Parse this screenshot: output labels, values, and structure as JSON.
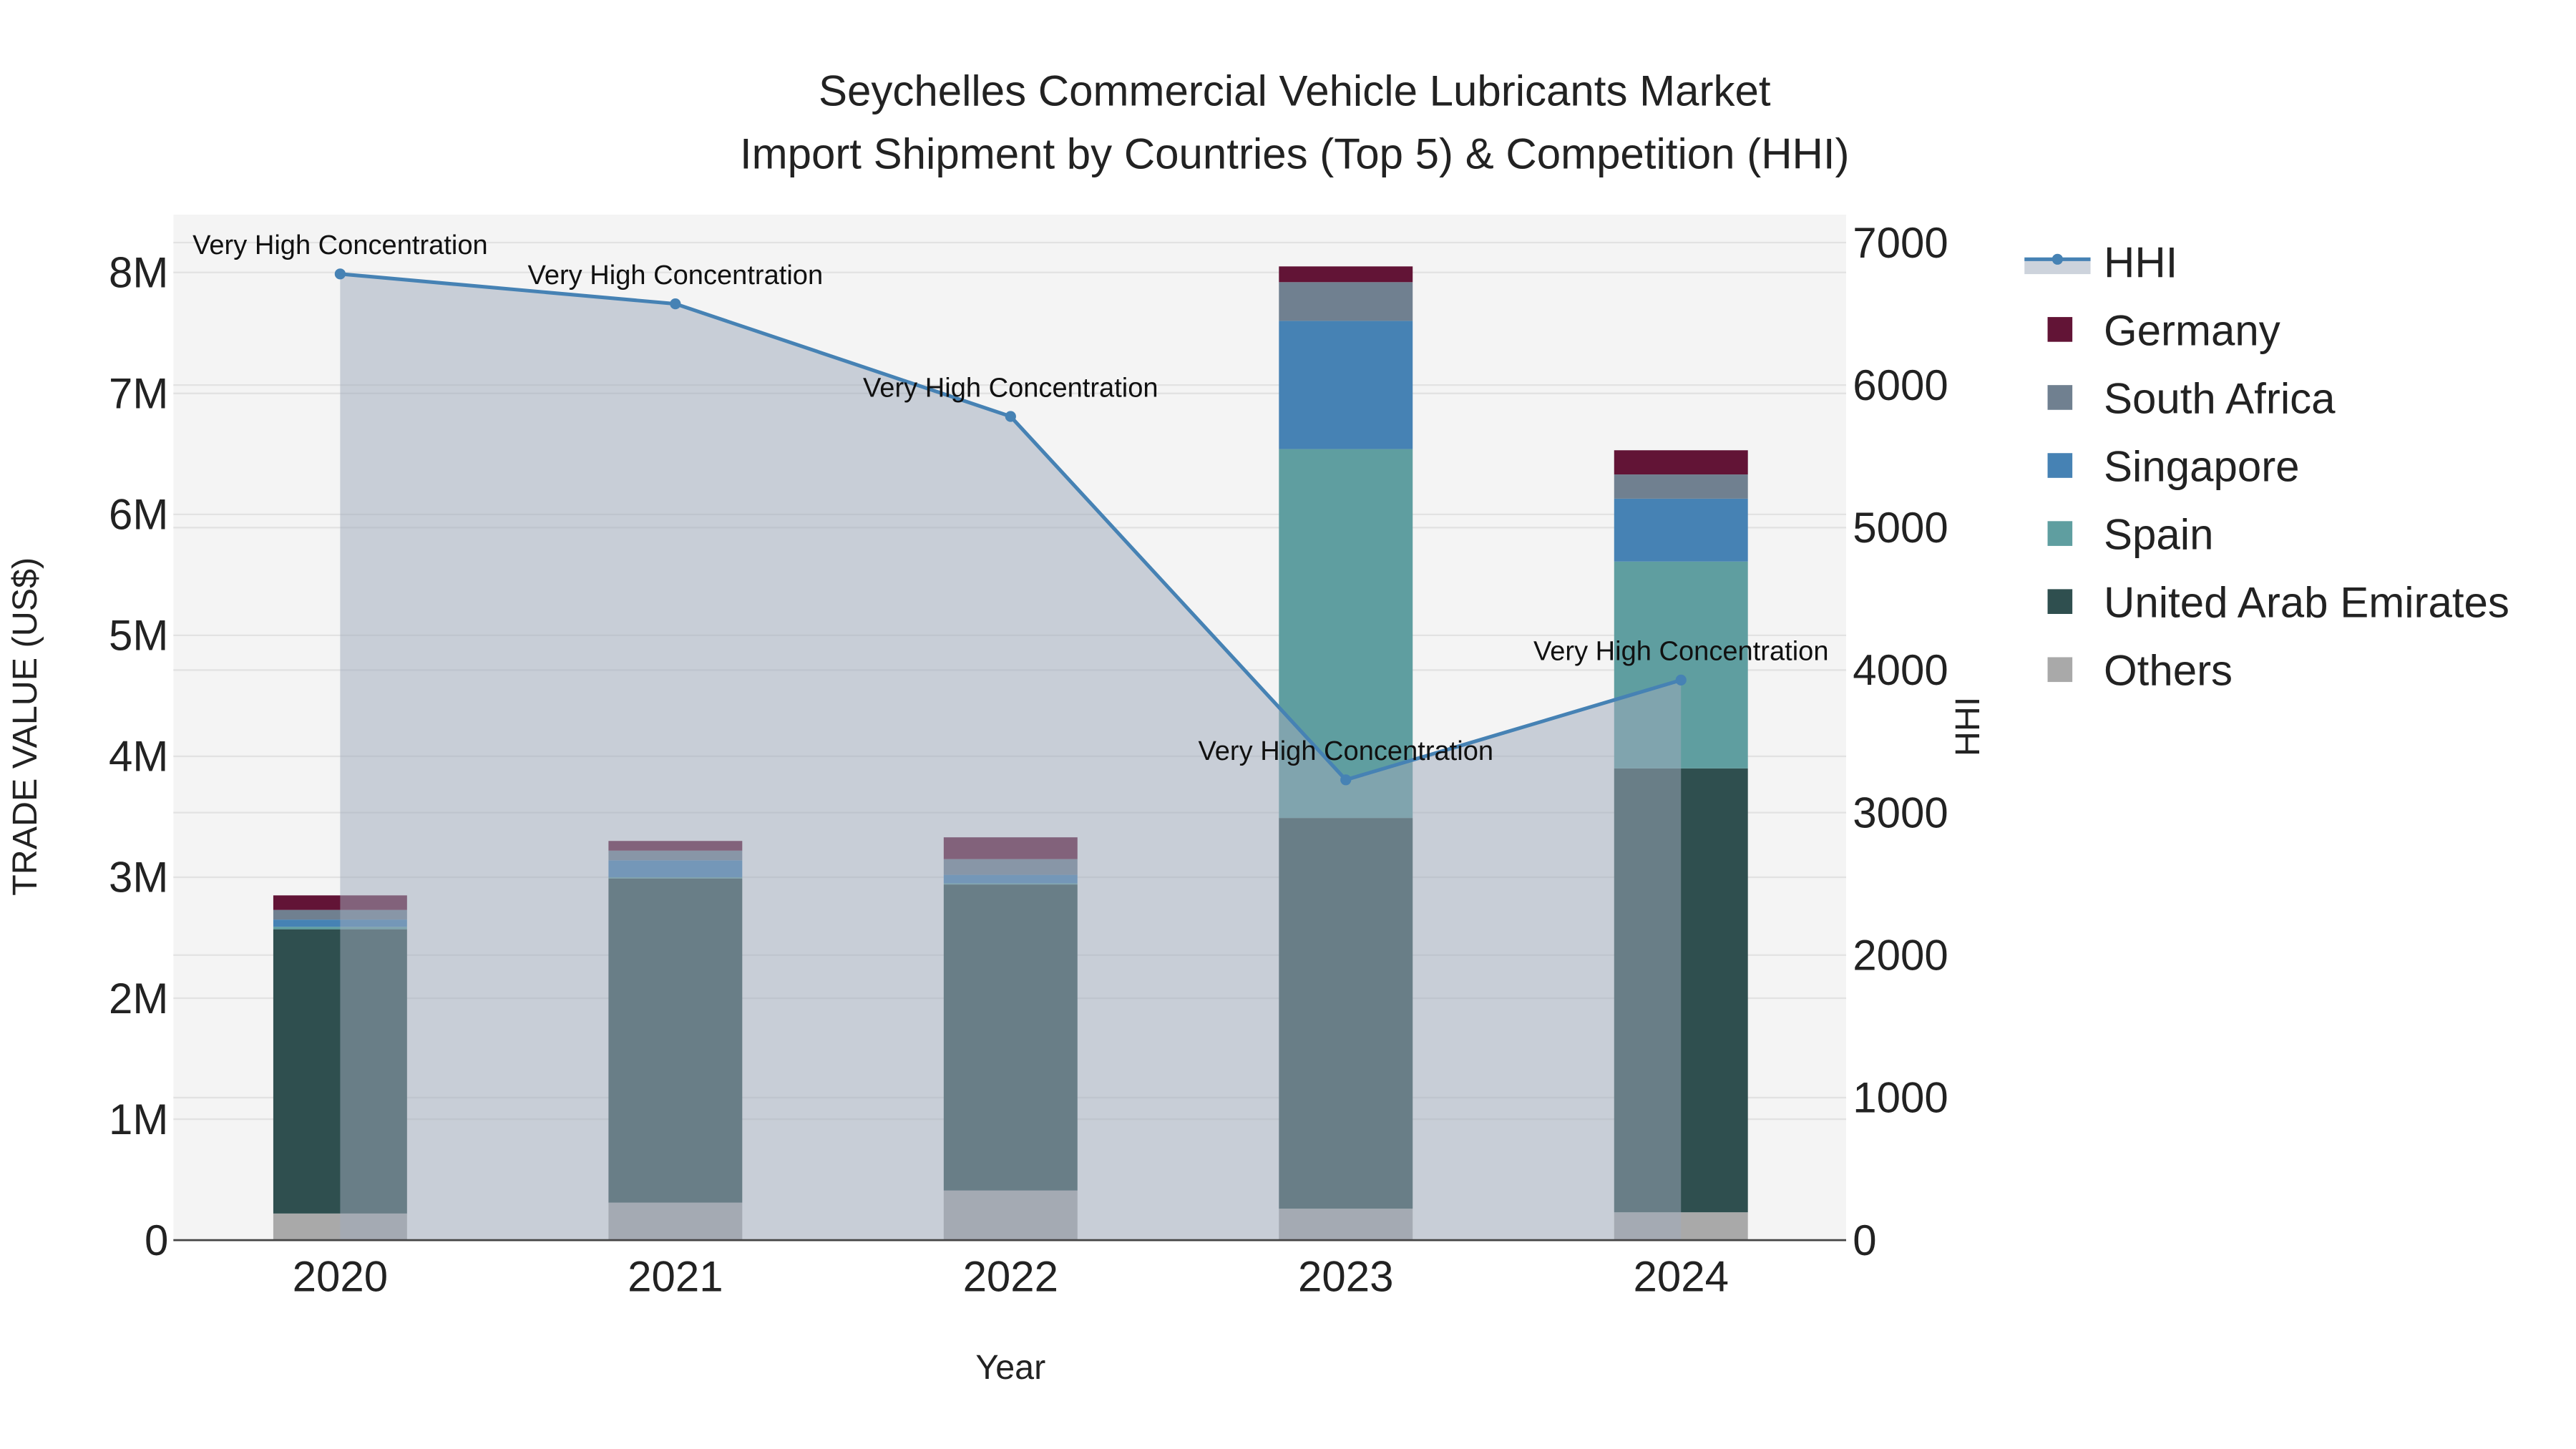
{
  "chart_data": {
    "type": "bar",
    "stacked": true,
    "title": "Seychelles Commercial Vehicle Lubricants Market",
    "subtitle": "Import Shipment by Countries (Top 5) & Competition (HHI)",
    "xlabel": "Year",
    "ylabel": "TRADE VALUE (US$)",
    "y2label": "HHI",
    "categories": [
      "2020",
      "2021",
      "2022",
      "2023",
      "2024"
    ],
    "ylim": [
      0,
      8500000
    ],
    "y2lim": [
      0,
      7200
    ],
    "yticks": [
      {
        "v": 0,
        "label": "0"
      },
      {
        "v": 1000000,
        "label": "1M"
      },
      {
        "v": 2000000,
        "label": "2M"
      },
      {
        "v": 3000000,
        "label": "3M"
      },
      {
        "v": 4000000,
        "label": "4M"
      },
      {
        "v": 5000000,
        "label": "5M"
      },
      {
        "v": 6000000,
        "label": "6M"
      },
      {
        "v": 7000000,
        "label": "7M"
      },
      {
        "v": 8000000,
        "label": "8M"
      }
    ],
    "y2ticks": [
      {
        "v": 0,
        "label": "0"
      },
      {
        "v": 1000,
        "label": "1000"
      },
      {
        "v": 2000,
        "label": "2000"
      },
      {
        "v": 3000,
        "label": "3000"
      },
      {
        "v": 4000,
        "label": "4000"
      },
      {
        "v": 5000,
        "label": "5000"
      },
      {
        "v": 6000,
        "label": "6000"
      },
      {
        "v": 7000,
        "label": "7000"
      }
    ],
    "series": [
      {
        "name": "Others",
        "color": "#a9a9a9",
        "values": [
          220000,
          310000,
          410000,
          260000,
          230000
        ]
      },
      {
        "name": "United Arab Emirates",
        "color": "#2f4f4f",
        "values": [
          2350000,
          2680000,
          2530000,
          3230000,
          3670000
        ]
      },
      {
        "name": "Spain",
        "color": "#5f9ea0",
        "values": [
          20000,
          10000,
          10000,
          3050000,
          1710000
        ]
      },
      {
        "name": "Singapore",
        "color": "#4682b4",
        "values": [
          60000,
          140000,
          70000,
          1060000,
          520000
        ]
      },
      {
        "name": "South Africa",
        "color": "#708090",
        "values": [
          80000,
          80000,
          130000,
          320000,
          200000
        ]
      },
      {
        "name": "Germany",
        "color": "#621436",
        "values": [
          120000,
          80000,
          180000,
          130000,
          200000
        ]
      }
    ],
    "hhi": {
      "name": "HHI",
      "color": "#4682b4",
      "values": [
        6780,
        6570,
        5780,
        3230,
        3930
      ]
    },
    "annotations": [
      "Very High Concentration",
      "Very High Concentration",
      "Very High Concentration",
      "Very High Concentration",
      "Very High Concentration"
    ],
    "legend": [
      "HHI",
      "Germany",
      "South Africa",
      "Singapore",
      "Spain",
      "United Arab Emirates",
      "Others"
    ],
    "legend_position": "right",
    "grid": true
  }
}
